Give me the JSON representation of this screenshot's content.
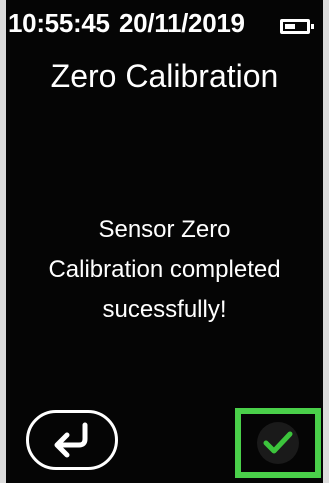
{
  "status_bar": {
    "time": "10:55:45",
    "date": "20/11/2019",
    "battery_icon": "battery-icon"
  },
  "screen": {
    "title": "Zero Calibration",
    "message_lines": [
      "Sensor Zero",
      "Calibration completed",
      "sucessfully!"
    ]
  },
  "controls": {
    "back_icon": "return-arrow-icon",
    "confirm_icon": "checkmark-icon",
    "confirm_highlight_color": "#4ad04a",
    "checkmark_color": "#3cc43c"
  }
}
